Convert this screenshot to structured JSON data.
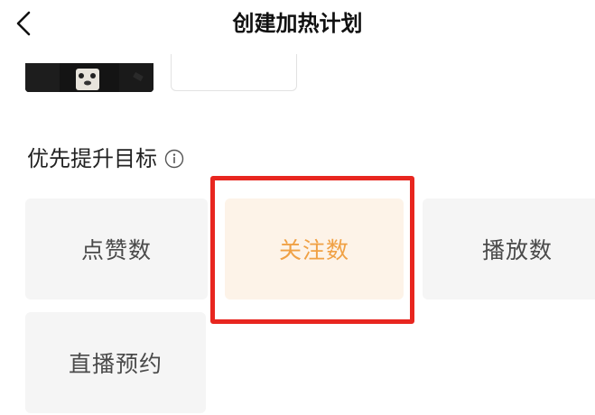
{
  "header": {
    "title": "创建加热计划",
    "back_icon": "chevron-left-icon"
  },
  "section": {
    "title": "优先提升目标",
    "info_icon": "info-icon"
  },
  "options": [
    {
      "label": "点赞数",
      "selected": false
    },
    {
      "label": "关注数",
      "selected": true
    },
    {
      "label": "播放数",
      "selected": false
    },
    {
      "label": "直播预约",
      "selected": false
    }
  ],
  "colors": {
    "selected_text": "#f0a145",
    "selected_bg": "#fdf3e8",
    "tile_bg": "#f5f5f5",
    "highlight_border": "#e8261f"
  }
}
